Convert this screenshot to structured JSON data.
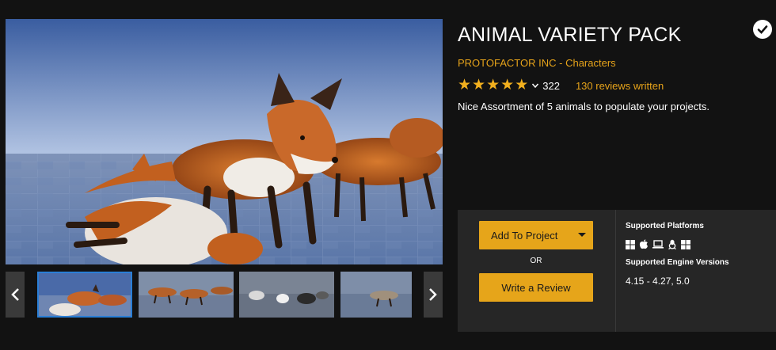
{
  "product": {
    "title": "ANIMAL VARIETY PACK",
    "publisher": "PROTOFACTOR INC",
    "separator": "-",
    "category": "Characters",
    "rating_count": "322",
    "reviews_link": "130 reviews written",
    "description": "Nice Assortment of 5 animals to populate your projects.",
    "rating": 5,
    "verified_icon": "check-circle-icon"
  },
  "gallery": {
    "prev_icon": "chevron-left-icon",
    "next_icon": "chevron-right-icon",
    "thumbnails": [
      "thumb-foxes-closeup",
      "thumb-foxes-running",
      "thumb-wolves",
      "thumb-fox-walking"
    ],
    "active_index": 0
  },
  "purchase": {
    "add_label": "Add To Project",
    "or_label": "OR",
    "review_label": "Write a Review"
  },
  "support": {
    "platforms_heading": "Supported Platforms",
    "platforms": [
      "windows-icon",
      "apple-icon",
      "laptop-icon",
      "linux-icon",
      "windows-icon"
    ],
    "versions_heading": "Supported Engine Versions",
    "versions": "4.15 - 4.27, 5.0"
  },
  "colors": {
    "accent": "#e6a51a",
    "background": "#121212",
    "panel": "#262626"
  }
}
